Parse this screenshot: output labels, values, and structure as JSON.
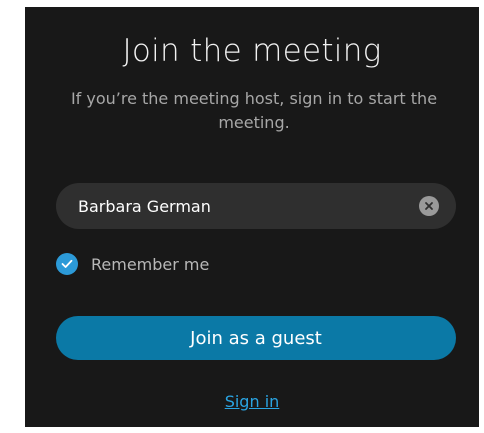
{
  "dialog": {
    "title": "Join the meeting",
    "subtitle": "If you’re the meeting host, sign in to start the meeting."
  },
  "name_field": {
    "value": "Barbara German",
    "clear_icon": "clear-circle-icon"
  },
  "remember": {
    "label": "Remember me",
    "checked": true,
    "icon": "checkmark-icon"
  },
  "actions": {
    "join_guest_label": "Join as a guest",
    "sign_in_label": "Sign in"
  },
  "colors": {
    "background": "#181818",
    "input_background": "#2f2f2f",
    "accent": "#0b79a6",
    "checkbox": "#2c9ad8",
    "link": "#2aa4e2"
  }
}
